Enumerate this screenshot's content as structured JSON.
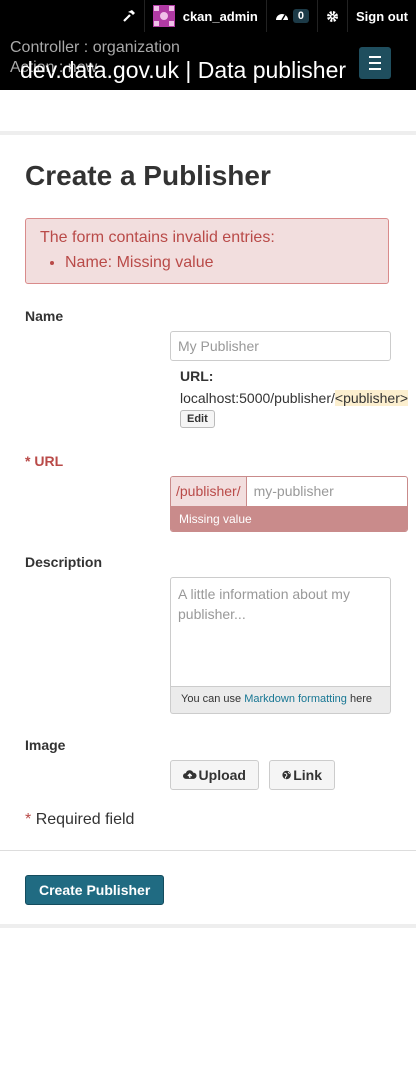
{
  "header": {
    "username": "ckan_admin",
    "dashboard_count": "0",
    "sign_out": "Sign out",
    "debug_controller": "Controller : organization",
    "debug_action": "Action : new",
    "site_title": "dev.data.gov.uk | Data publisher"
  },
  "page": {
    "title": "Create a Publisher"
  },
  "alert": {
    "heading": "The form contains invalid entries:",
    "errors": [
      "Name: Missing value"
    ]
  },
  "form": {
    "name_label": "Name",
    "name_placeholder": "My Publisher",
    "url_preview_label": "URL:",
    "url_preview_path": "localhost:5000/publisher/",
    "url_preview_slug": "<publisher>",
    "edit_label": "Edit",
    "url_required_star": "*",
    "url_label": "URL",
    "url_prefix": "/publisher/",
    "url_placeholder": "my-publisher",
    "url_error": "Missing value",
    "description_label": "Description",
    "description_placeholder": "A little information about my publisher...",
    "markdown_prefix": "You can use ",
    "markdown_link": "Markdown formatting",
    "markdown_suffix": " here",
    "image_label": "Image",
    "upload_label": "Upload",
    "link_label": "Link",
    "required_star": "*",
    "required_note": "Required field",
    "submit_label": "Create Publisher"
  },
  "colors": {
    "header_bg": "#000000",
    "error_red": "#b94a48",
    "primary_button": "#206b82",
    "link": "#187794"
  }
}
